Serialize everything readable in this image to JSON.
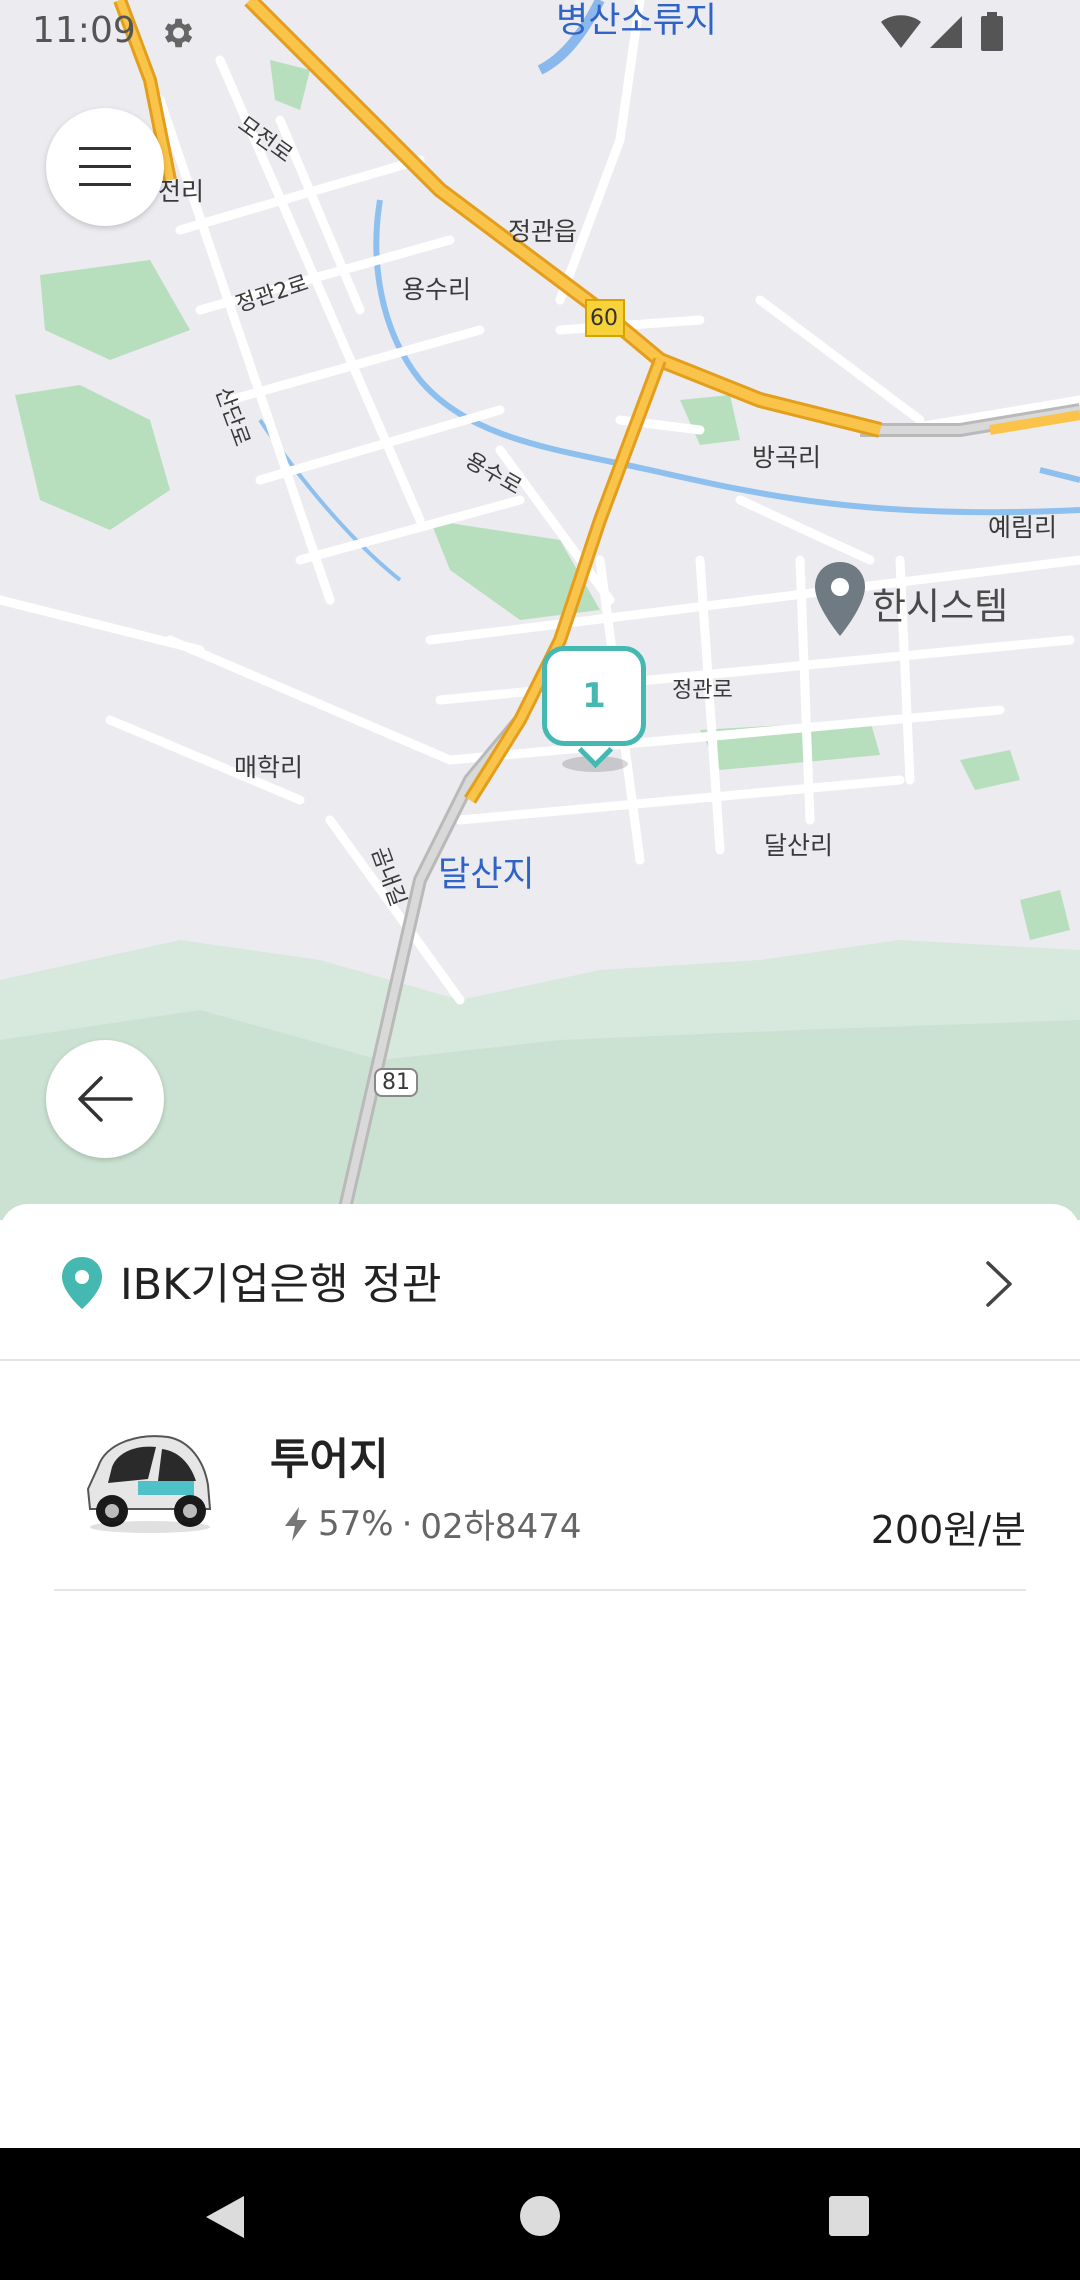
{
  "status_bar": {
    "time": "11:09",
    "icons": [
      "gear-icon",
      "wifi-icon",
      "signal-icon",
      "battery-icon"
    ]
  },
  "map": {
    "labels": {
      "byeongsan": "병산소류지",
      "jeonri": "전리",
      "mojeonro": "모전로",
      "jeonggwaneup": "정관읍",
      "jeonggwan2ro": "정관2로",
      "yongsuri": "용수리",
      "route60": "60",
      "sandanro": "산단로",
      "banggokri": "방곡리",
      "yongsuro": "용수로",
      "yerimri": "예림리",
      "jeonggwanro": "정관로",
      "maehakri": "매학리",
      "dalsanri": "달산리",
      "dalsanji": "달산지",
      "gimbokgil": "곰내길",
      "route81": "81"
    },
    "poi": {
      "name": "한시스템",
      "icon": "map-pin-icon"
    },
    "cluster": {
      "count": "1"
    }
  },
  "buttons": {
    "menu_icon": "hamburger-menu-icon",
    "back_icon": "arrow-left-icon"
  },
  "station": {
    "name": "IBK기업은행 정관",
    "icon": "location-pin-icon",
    "chevron": "chevron-right-icon"
  },
  "car": {
    "name": "투어지",
    "battery": "57%",
    "separator": "·",
    "plate": "02하8474",
    "price": "200원/분",
    "battery_icon": "lightning-icon"
  },
  "colors": {
    "accent": "#45b8b2",
    "road": "#f7b733",
    "park": "#8fd19e",
    "water": "#6ea9e6"
  },
  "nav_bar": {
    "buttons": [
      "back-triangle-icon",
      "home-circle-icon",
      "recents-square-icon"
    ]
  }
}
